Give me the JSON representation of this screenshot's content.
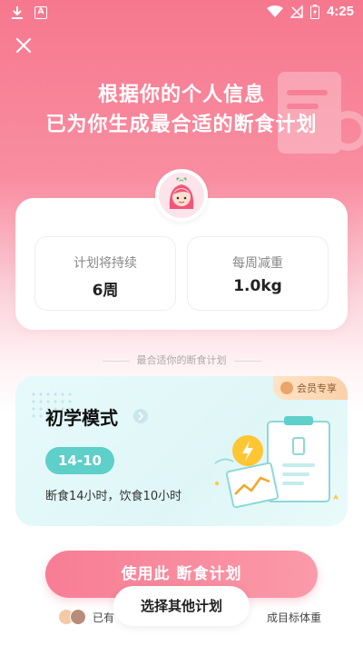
{
  "status_bar": {
    "time": "4:25",
    "icons": [
      "download-icon",
      "font-a-icon",
      "wifi-icon",
      "no-signal-icon",
      "battery-charging-icon"
    ],
    "a_label": "A"
  },
  "header": {
    "close_icon": "close-icon",
    "title_line1": "根据你的个人信息",
    "title_line2": "已为你生成最合适的断食计划"
  },
  "summary": {
    "duration_label": "计划将持续",
    "duration_value": "6周",
    "weekly_label": "每周减重",
    "weekly_value": "1.0kg"
  },
  "plan_section": {
    "caption": "最合适你的断食计划",
    "badge": "会员专享",
    "title": "初学模式",
    "pill": "14-10",
    "description": "断食14小时，饮食10小时"
  },
  "actions": {
    "primary": "使用此 断食计划",
    "secondary": "选择其他计划"
  },
  "footer": {
    "text_left": "已有",
    "text_right": "成目标体重"
  },
  "colors": {
    "brand_pink": "#f77d95",
    "plan_teal": "#5ecfc9",
    "member_gold": "#fcd0a8"
  }
}
